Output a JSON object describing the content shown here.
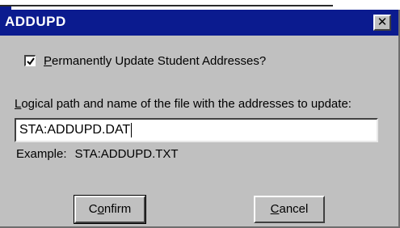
{
  "window": {
    "title": "ADDUPD",
    "close_glyph": "✕"
  },
  "checkbox": {
    "checked": true,
    "label_accel": "P",
    "label_rest": "ermanently Update Student Addresses?"
  },
  "path_field": {
    "label_accel": "L",
    "label_rest": "ogical path and name of the file with the addresses to update:",
    "value": "STA:ADDUPD.DAT"
  },
  "example": {
    "label": "Example:",
    "value": "STA:ADDUPD.TXT"
  },
  "buttons": {
    "confirm_pre": "C",
    "confirm_accel": "o",
    "confirm_post": "nfirm",
    "cancel_accel": "C",
    "cancel_rest": "ancel"
  },
  "colors": {
    "titlebar": "#0b1b8f",
    "face": "#c0c0c0"
  }
}
